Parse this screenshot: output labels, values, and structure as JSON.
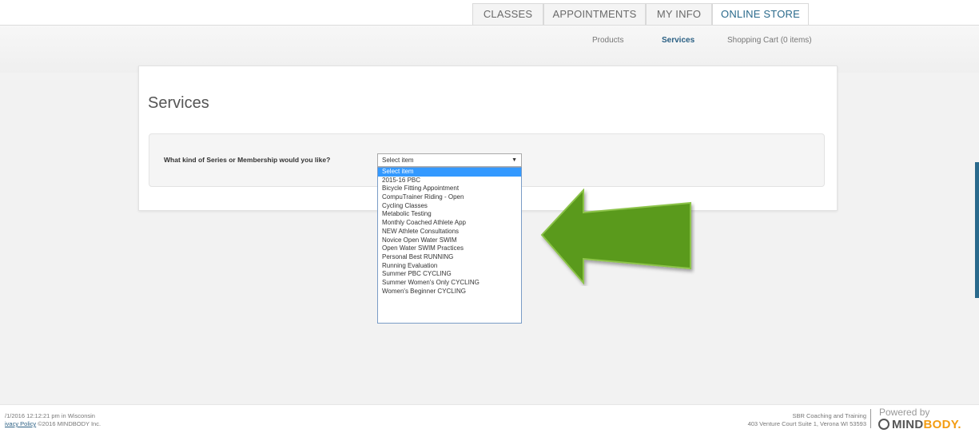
{
  "nav": {
    "tabs": [
      {
        "label": "CLASSES",
        "active": false
      },
      {
        "label": "APPOINTMENTS",
        "active": false
      },
      {
        "label": "MY INFO",
        "active": false
      },
      {
        "label": "ONLINE STORE",
        "active": true
      }
    ],
    "sub": [
      {
        "label": "Products",
        "active": false
      },
      {
        "label": "Services",
        "active": true
      },
      {
        "label": "Shopping Cart (0 items)",
        "active": false
      }
    ]
  },
  "page": {
    "title": "Services",
    "question": "What kind of Series or Membership would you like?"
  },
  "select": {
    "value": "Select item",
    "options": [
      "Select item",
      "2015-16 PBC",
      "Bicycle Fitting Appointment",
      "CompuTrainer Riding - Open",
      "Cycling Classes",
      "Metabolic Testing",
      "Monthly Coached Athlete App",
      "NEW Athlete Consultations",
      "Novice Open Water SWIM",
      "Open Water SWIM Practices",
      "Personal Best RUNNING",
      "Running Evaluation",
      "Summer PBC CYCLING",
      "Summer Women's Only CYCLING",
      "Women's Beginner CYCLING"
    ],
    "highlighted_index": 0
  },
  "annotation": {
    "arrow_color": "#5a9a1f",
    "icon": "arrow-left-icon"
  },
  "footer": {
    "timestamp": "/1/2016 12:12:21 pm in Wisconsin",
    "privacy_link": "ivacy Policy",
    "copyright": "©2016 MINDBODY Inc.",
    "business_name": "SBR Coaching and Training",
    "address": "403 Venture Court Suite 1, Verona WI 53593",
    "powered_by": "Powered by",
    "brand": "MIND",
    "brand_accent": "BODY."
  }
}
